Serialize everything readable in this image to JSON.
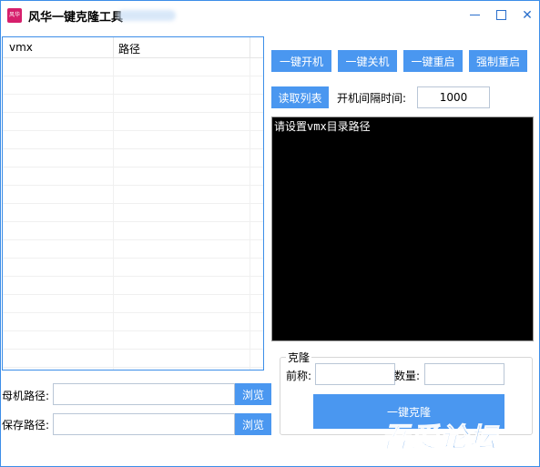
{
  "window": {
    "title": "风华一键克隆工具",
    "icon_text": "风华"
  },
  "list": {
    "columns": [
      "vmx",
      "路径"
    ],
    "rows": []
  },
  "toolbar": {
    "power_on_all": "一键开机",
    "power_off_all": "一键关机",
    "restart_all": "一键重启",
    "force_restart": "强制重启",
    "read_list": "读取列表",
    "interval_label": "开机间隔时间:",
    "interval_value": "1000"
  },
  "console": {
    "text": "请设置vmx目录路径"
  },
  "paths": {
    "parent_label": "母机路径:",
    "parent_value": "",
    "save_label": "保存路径:",
    "save_value": "",
    "browse": "浏览"
  },
  "clone": {
    "group_title": "克隆",
    "prefix_label": "前称:",
    "prefix_value": "",
    "count_label": "数量:",
    "count_value": "",
    "clone_button": "一键克隆"
  },
  "watermark": "吾爱论坛",
  "colors": {
    "accent": "#4a97f0",
    "console_bg": "#000000",
    "border": "#3c8ee8"
  }
}
